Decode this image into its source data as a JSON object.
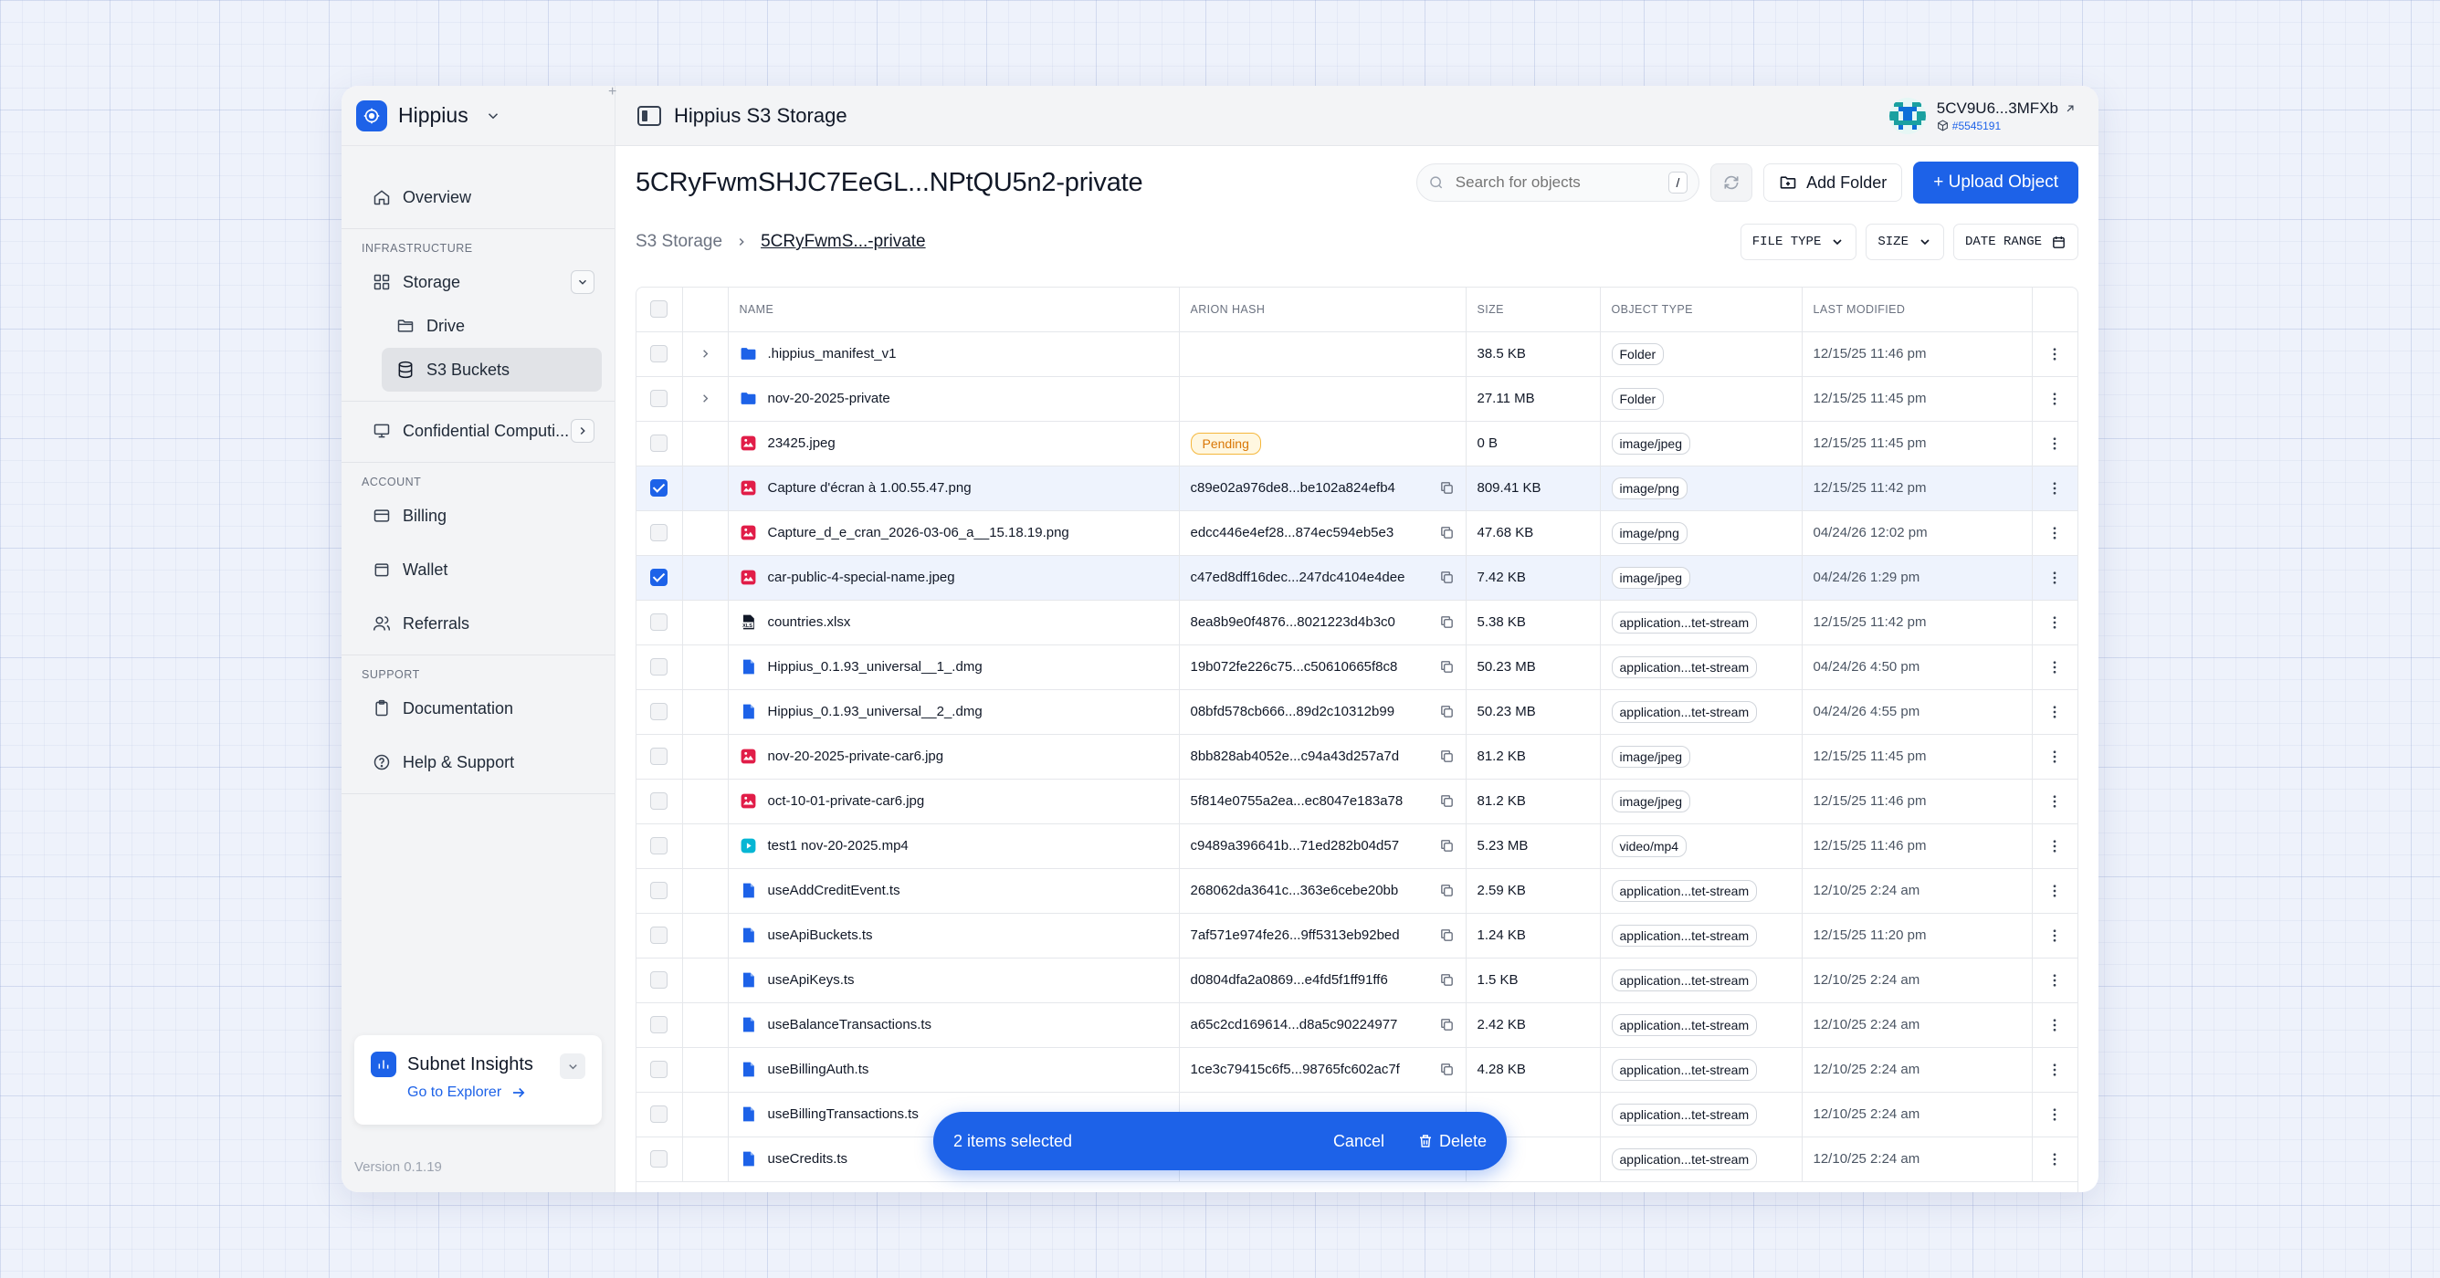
{
  "colors": {
    "accent": "#1d62e8",
    "pending": "#f5b73c"
  },
  "sidebar": {
    "brand": "Hippius",
    "overview": "Overview",
    "section_infrastructure": "INFRASTRUCTURE",
    "storage": "Storage",
    "drive": "Drive",
    "s3_buckets": "S3 Buckets",
    "confidential": "Confidential Computi...",
    "section_account": "ACCOUNT",
    "billing": "Billing",
    "wallet": "Wallet",
    "referrals": "Referrals",
    "section_support": "SUPPORT",
    "documentation": "Documentation",
    "help": "Help & Support",
    "insights_title": "Subnet Insights",
    "insights_link": "Go to Explorer",
    "version": "Version 0.1.19"
  },
  "topbar": {
    "title": "Hippius S3 Storage",
    "account_id": "5CV9U6...3MFXb",
    "account_sub": "#5545191"
  },
  "header": {
    "bucket_title": "5CRyFwmSHJC7EeGL...NPtQU5n2-private",
    "search_placeholder": "Search for objects",
    "search_kbd": "/",
    "add_folder": "Add Folder",
    "upload": "+ Upload Object"
  },
  "breadcrumb": {
    "root": "S3 Storage",
    "current": "5CRyFwmS...-private"
  },
  "filters": {
    "file_type": "FILE TYPE",
    "size": "SIZE",
    "date_range": "DATE RANGE"
  },
  "table": {
    "columns": [
      "NAME",
      "ARION HASH",
      "SIZE",
      "OBJECT TYPE",
      "LAST MODIFIED"
    ],
    "rows": [
      {
        "name": ".hippius_manifest_v1",
        "icon": "folder",
        "hash": "",
        "size": "38.5 KB",
        "type": "Folder",
        "modified": "12/15/25 11:46 pm",
        "selected": false,
        "expandable": true
      },
      {
        "name": "nov-20-2025-private",
        "icon": "folder",
        "hash": "",
        "size": "27.11 MB",
        "type": "Folder",
        "modified": "12/15/25 11:45 pm",
        "selected": false,
        "expandable": true
      },
      {
        "name": "23425.jpeg",
        "icon": "image",
        "hash": "",
        "status": "Pending",
        "size": "0 B",
        "type": "image/jpeg",
        "modified": "12/15/25 11:45 pm",
        "selected": false
      },
      {
        "name": "Capture d'écran à 1.00.55.47.png",
        "icon": "image",
        "hash": "c89e02a976de8...be102a824efb4",
        "size": "809.41 KB",
        "type": "image/png",
        "modified": "12/15/25 11:42 pm",
        "selected": true
      },
      {
        "name": "Capture_d_e_cran_2026-03-06_a__15.18.19.png",
        "icon": "image",
        "hash": "edcc446e4ef28...874ec594eb5e3",
        "size": "47.68 KB",
        "type": "image/png",
        "modified": "04/24/26 12:02 pm",
        "selected": false
      },
      {
        "name": "car-public-4-special-name.jpeg",
        "icon": "image",
        "hash": "c47ed8dff16dec...247dc4104e4dee",
        "size": "7.42 KB",
        "type": "image/jpeg",
        "modified": "04/24/26 1:29 pm",
        "selected": true
      },
      {
        "name": "countries.xlsx",
        "icon": "xls",
        "hash": "8ea8b9e0f4876...8021223d4b3c0",
        "size": "5.38 KB",
        "type": "application...tet-stream",
        "modified": "12/15/25 11:42 pm",
        "selected": false
      },
      {
        "name": "Hippius_0.1.93_universal__1_.dmg",
        "icon": "file",
        "hash": "19b072fe226c75...c50610665f8c8",
        "size": "50.23 MB",
        "type": "application...tet-stream",
        "modified": "04/24/26 4:50 pm",
        "selected": false
      },
      {
        "name": "Hippius_0.1.93_universal__2_.dmg",
        "icon": "file",
        "hash": "08bfd578cb666...89d2c10312b99",
        "size": "50.23 MB",
        "type": "application...tet-stream",
        "modified": "04/24/26 4:55 pm",
        "selected": false
      },
      {
        "name": "nov-20-2025-private-car6.jpg",
        "icon": "image",
        "hash": "8bb828ab4052e...c94a43d257a7d",
        "size": "81.2 KB",
        "type": "image/jpeg",
        "modified": "12/15/25 11:45 pm",
        "selected": false
      },
      {
        "name": "oct-10-01-private-car6.jpg",
        "icon": "image",
        "hash": "5f814e0755a2ea...ec8047e183a78",
        "size": "81.2 KB",
        "type": "image/jpeg",
        "modified": "12/15/25 11:46 pm",
        "selected": false
      },
      {
        "name": "test1 nov-20-2025.mp4",
        "icon": "video",
        "hash": "c9489a396641b...71ed282b04d57",
        "size": "5.23 MB",
        "type": "video/mp4",
        "modified": "12/15/25 11:46 pm",
        "selected": false
      },
      {
        "name": "useAddCreditEvent.ts",
        "icon": "file",
        "hash": "268062da3641c...363e6cebe20bb",
        "size": "2.59 KB",
        "type": "application...tet-stream",
        "modified": "12/10/25 2:24 am",
        "selected": false
      },
      {
        "name": "useApiBuckets.ts",
        "icon": "file",
        "hash": "7af571e974fe26...9ff5313eb92bed",
        "size": "1.24 KB",
        "type": "application...tet-stream",
        "modified": "12/15/25 11:20 pm",
        "selected": false
      },
      {
        "name": "useApiKeys.ts",
        "icon": "file",
        "hash": "d0804dfa2a0869...e4fd5f1ff91ff6",
        "size": "1.5 KB",
        "type": "application...tet-stream",
        "modified": "12/10/25 2:24 am",
        "selected": false
      },
      {
        "name": "useBalanceTransactions.ts",
        "icon": "file",
        "hash": "a65c2cd169614...d8a5c90224977",
        "size": "2.42 KB",
        "type": "application...tet-stream",
        "modified": "12/10/25 2:24 am",
        "selected": false
      },
      {
        "name": "useBillingAuth.ts",
        "icon": "file",
        "hash": "1ce3c79415c6f5...98765fc602ac7f",
        "size": "4.28 KB",
        "type": "application...tet-stream",
        "modified": "12/10/25 2:24 am",
        "selected": false
      },
      {
        "name": "useBillingTransactions.ts",
        "icon": "file",
        "hash": "",
        "size": "",
        "type": "application...tet-stream",
        "modified": "12/10/25 2:24 am",
        "selected": false
      },
      {
        "name": "useCredits.ts",
        "icon": "file",
        "hash": "",
        "size": "",
        "type": "application...tet-stream",
        "modified": "12/10/25 2:24 am",
        "selected": false
      }
    ]
  },
  "selection_bar": {
    "count": "2 items selected",
    "cancel": "Cancel",
    "delete": "Delete"
  }
}
